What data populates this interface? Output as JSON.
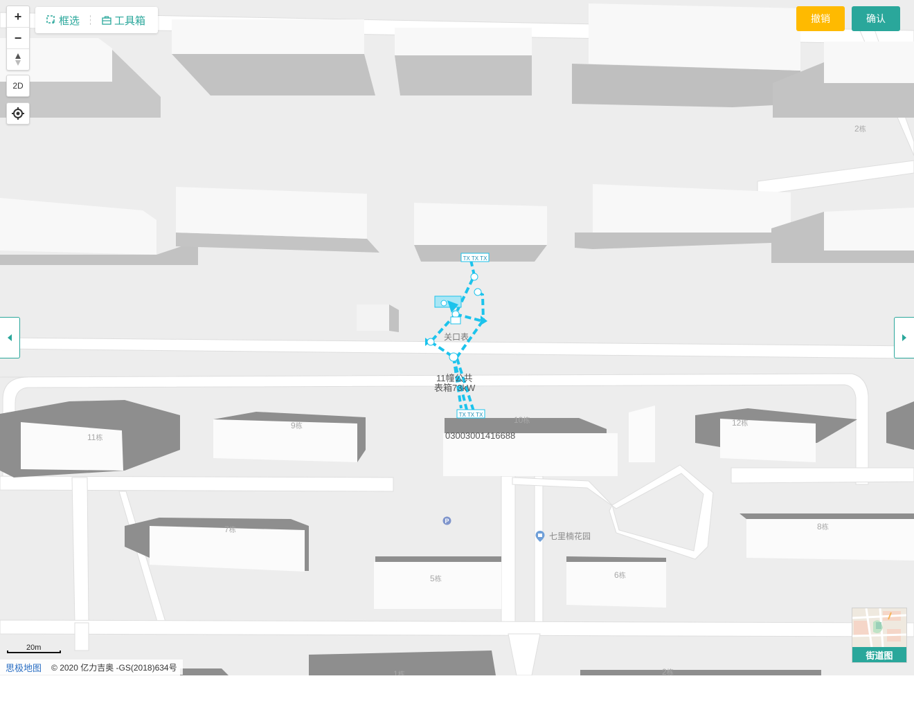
{
  "map": {
    "building_labels": [
      {
        "num": "2",
        "unit": "栋"
      },
      {
        "num": "11",
        "unit": "栋"
      },
      {
        "num": "9",
        "unit": "栋"
      },
      {
        "num": "10",
        "unit": "栋"
      },
      {
        "num": "12",
        "unit": "栋"
      },
      {
        "num": "7",
        "unit": "栋"
      },
      {
        "num": "8",
        "unit": "栋"
      },
      {
        "num": "5",
        "unit": "栋"
      },
      {
        "num": "6",
        "unit": "栋"
      },
      {
        "num": "1",
        "unit": "栋"
      },
      {
        "num": "2",
        "unit": "栋"
      }
    ],
    "poi": {
      "name": "七里楠花园"
    },
    "network": {
      "junction_label": "关口表",
      "box_label_line1": "11幢公共",
      "box_label_line2": "表箱73kW",
      "meter_id": "03003001416688",
      "tag_top": "TX TX TX",
      "tag_bottom": "TX TX TX",
      "line_color": "#1cc3ec"
    }
  },
  "controls": {
    "zoom_in": "+",
    "zoom_out": "−",
    "mode_2d": "2D"
  },
  "toolbar": {
    "select_label": "框选",
    "toolbox_label": "工具箱"
  },
  "actions": {
    "cancel_label": "撤销",
    "confirm_label": "确认",
    "cancel_color": "#ffba00",
    "confirm_color": "#2aa79b"
  },
  "street_view": {
    "label": "街道图"
  },
  "scale": {
    "label": "20m"
  },
  "attribution": {
    "brand": "思极地图",
    "copyright": "© 2020 亿力吉奥 -GS(2018)634号"
  }
}
